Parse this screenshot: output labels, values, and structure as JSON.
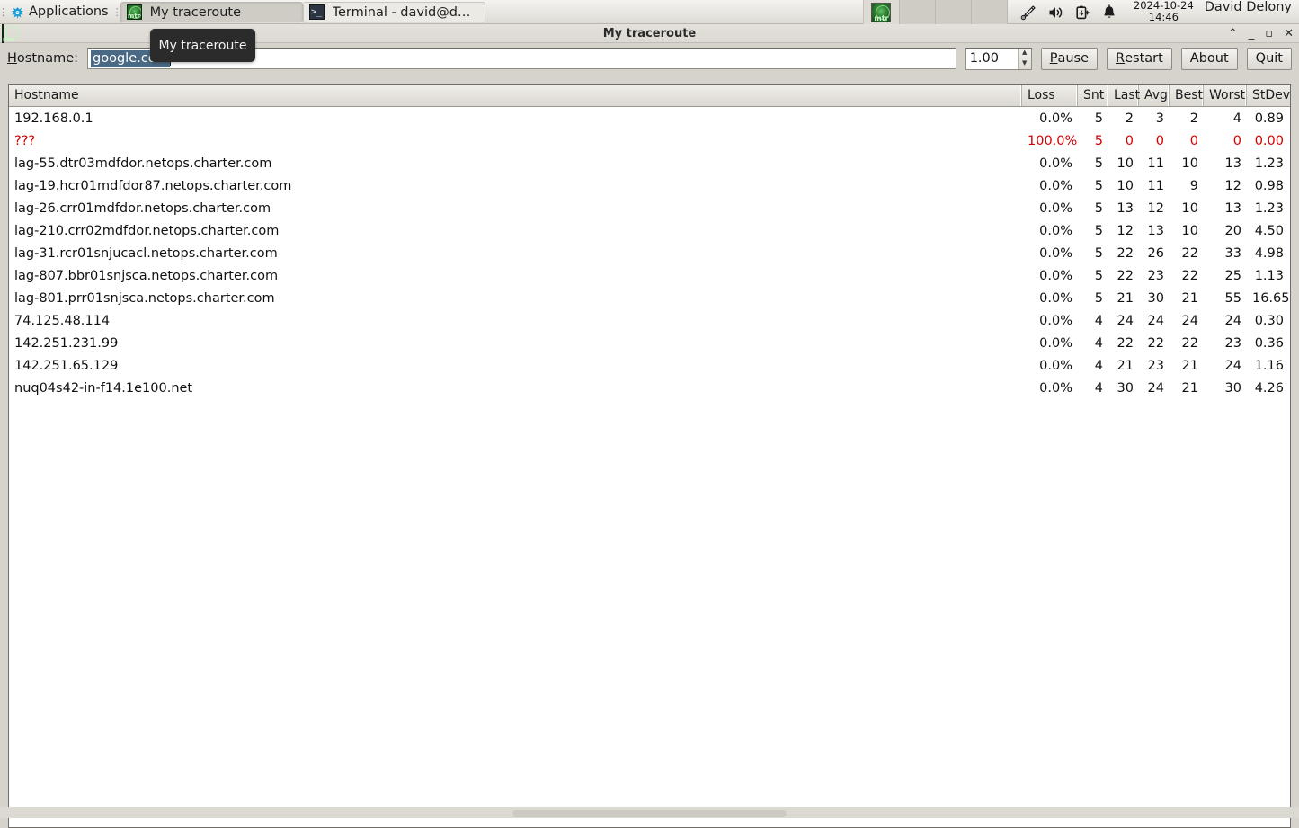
{
  "taskbar": {
    "applications_label": "Applications",
    "applications_icon": "xfce-mouse-icon",
    "buttons": [
      {
        "label": "My traceroute",
        "icon": "mtr-icon",
        "active": true
      },
      {
        "label": "Terminal - david@debia...",
        "icon": "terminal-icon",
        "active": false
      }
    ],
    "pager_icon": "mtr-icon",
    "tray_icons": [
      "pen-tablet-icon",
      "volume-icon",
      "battery-charging-icon",
      "notification-bell-icon"
    ],
    "clock_date": "2024-10-24",
    "clock_time": "14:46",
    "user_name": "David Delony"
  },
  "window": {
    "title": "My traceroute",
    "icon": "mtr-icon",
    "buttons": {
      "shade": "⌃",
      "minimize": "_",
      "maximize": "▫",
      "close": "✕"
    }
  },
  "tooltip": {
    "text": "My traceroute"
  },
  "toolbar": {
    "hostname_label_mnemonic": "H",
    "hostname_label_rest": "ostname:",
    "hostname_value": "google.com",
    "hostname_placeholder": "",
    "interval_value": "1.00",
    "spinner_up": "▲",
    "spinner_down": "▼",
    "pause_mnemonic": "P",
    "pause_rest": "ause",
    "restart_mnemonic": "R",
    "restart_rest": "estart",
    "about_label": "About",
    "quit_label": "Quit"
  },
  "table": {
    "columns": [
      "Hostname",
      "Loss",
      "Snt",
      "Last",
      "Avg",
      "Best",
      "Worst",
      "StDev"
    ],
    "rows": [
      {
        "host": "192.168.0.1",
        "loss": "0.0%",
        "snt": "5",
        "last": "2",
        "avg": "3",
        "best": "2",
        "worst": "4",
        "stdev": "0.89",
        "error": false
      },
      {
        "host": "???",
        "loss": "100.0%",
        "snt": "5",
        "last": "0",
        "avg": "0",
        "best": "0",
        "worst": "0",
        "stdev": "0.00",
        "error": true
      },
      {
        "host": "lag-55.dtr03mdfdor.netops.charter.com",
        "loss": "0.0%",
        "snt": "5",
        "last": "10",
        "avg": "11",
        "best": "10",
        "worst": "13",
        "stdev": "1.23",
        "error": false
      },
      {
        "host": "lag-19.hcr01mdfdor87.netops.charter.com",
        "loss": "0.0%",
        "snt": "5",
        "last": "10",
        "avg": "11",
        "best": "9",
        "worst": "12",
        "stdev": "0.98",
        "error": false
      },
      {
        "host": "lag-26.crr01mdfdor.netops.charter.com",
        "loss": "0.0%",
        "snt": "5",
        "last": "13",
        "avg": "12",
        "best": "10",
        "worst": "13",
        "stdev": "1.23",
        "error": false
      },
      {
        "host": "lag-210.crr02mdfdor.netops.charter.com",
        "loss": "0.0%",
        "snt": "5",
        "last": "12",
        "avg": "13",
        "best": "10",
        "worst": "20",
        "stdev": "4.50",
        "error": false
      },
      {
        "host": "lag-31.rcr01snjucacl.netops.charter.com",
        "loss": "0.0%",
        "snt": "5",
        "last": "22",
        "avg": "26",
        "best": "22",
        "worst": "33",
        "stdev": "4.98",
        "error": false
      },
      {
        "host": "lag-807.bbr01snjsca.netops.charter.com",
        "loss": "0.0%",
        "snt": "5",
        "last": "22",
        "avg": "23",
        "best": "22",
        "worst": "25",
        "stdev": "1.13",
        "error": false
      },
      {
        "host": "lag-801.prr01snjsca.netops.charter.com",
        "loss": "0.0%",
        "snt": "5",
        "last": "21",
        "avg": "30",
        "best": "21",
        "worst": "55",
        "stdev": "16.65",
        "error": false
      },
      {
        "host": "74.125.48.114",
        "loss": "0.0%",
        "snt": "4",
        "last": "24",
        "avg": "24",
        "best": "24",
        "worst": "24",
        "stdev": "0.30",
        "error": false
      },
      {
        "host": "142.251.231.99",
        "loss": "0.0%",
        "snt": "4",
        "last": "22",
        "avg": "22",
        "best": "22",
        "worst": "23",
        "stdev": "0.36",
        "error": false
      },
      {
        "host": "142.251.65.129",
        "loss": "0.0%",
        "snt": "4",
        "last": "21",
        "avg": "23",
        "best": "21",
        "worst": "24",
        "stdev": "1.16",
        "error": false
      },
      {
        "host": "nuq04s42-in-f14.1e100.net",
        "loss": "0.0%",
        "snt": "4",
        "last": "30",
        "avg": "24",
        "best": "21",
        "worst": "30",
        "stdev": "4.26",
        "error": false
      }
    ]
  },
  "colors": {
    "error_red": "#d40000",
    "selection_blue": "#4a6984",
    "taskbar_bg": "#e8e6e1",
    "window_bg": "#d6d3cd"
  }
}
